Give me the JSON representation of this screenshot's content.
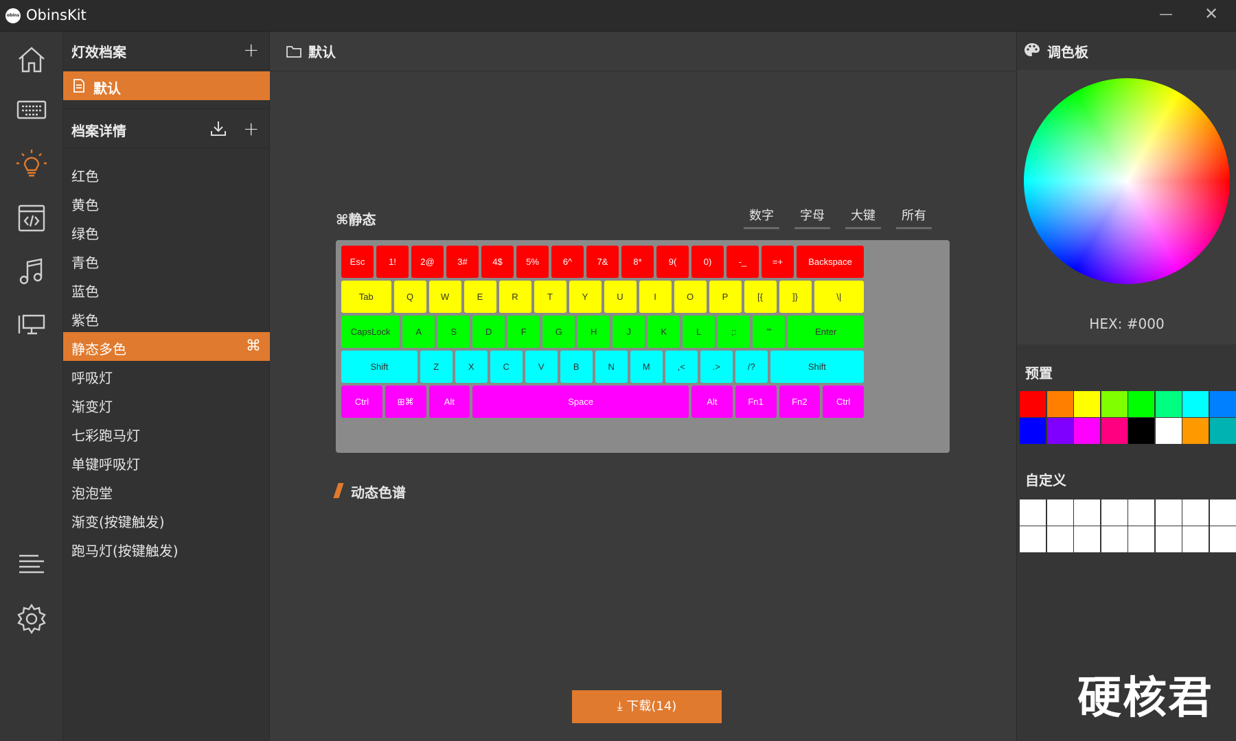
{
  "app": {
    "title": "ObinsKit",
    "logo_text": "obins"
  },
  "window": {
    "minimize": "—",
    "close": "✕"
  },
  "rail": [
    "home-icon",
    "keyboard-icon",
    "lighting-icon",
    "macro-icon",
    "music-icon",
    "monitor-icon",
    "menu-icon",
    "settings-icon"
  ],
  "profiles": {
    "title": "灯效档案",
    "add": "+",
    "items": [
      {
        "label": "默认",
        "selected": true
      }
    ]
  },
  "details": {
    "title": "档案详情",
    "add": "+",
    "items": [
      {
        "label": "红色"
      },
      {
        "label": "黄色"
      },
      {
        "label": "绿色"
      },
      {
        "label": "青色"
      },
      {
        "label": "蓝色"
      },
      {
        "label": "紫色"
      },
      {
        "label": "静态多色",
        "active": true,
        "badge": "⌘"
      },
      {
        "label": "呼吸灯"
      },
      {
        "label": "渐变灯"
      },
      {
        "label": "七彩跑马灯"
      },
      {
        "label": "单键呼吸灯"
      },
      {
        "label": "泡泡堂"
      },
      {
        "label": "渐变(按键触发)"
      },
      {
        "label": "跑马灯(按键触发)"
      }
    ]
  },
  "main": {
    "title": "默认",
    "static_label": "⌘静态",
    "filters": [
      "数字",
      "字母",
      "大键",
      "所有"
    ],
    "dynamic_label": "动态色谱",
    "download_label": "下载(14)",
    "keyboard": {
      "colors": {
        "red": "#ff0000",
        "yellow": "#ffff00",
        "green": "#00ff00",
        "cyan": "#00ffff",
        "magenta": "#ff00ff"
      },
      "rows": [
        {
          "color": "red",
          "keys": [
            {
              "l": "Esc",
              "w": 1
            },
            {
              "l": "1!",
              "w": 1
            },
            {
              "l": "2@",
              "w": 1
            },
            {
              "l": "3#",
              "w": 1
            },
            {
              "l": "4$",
              "w": 1
            },
            {
              "l": "5%",
              "w": 1
            },
            {
              "l": "6^",
              "w": 1
            },
            {
              "l": "7&",
              "w": 1
            },
            {
              "l": "8*",
              "w": 1
            },
            {
              "l": "9(",
              "w": 1
            },
            {
              "l": "0)",
              "w": 1
            },
            {
              "l": "-_",
              "w": 1
            },
            {
              "l": "=+",
              "w": 1
            },
            {
              "l": "Backspace",
              "w": 2
            }
          ]
        },
        {
          "color": "yellow",
          "keys": [
            {
              "l": "Tab",
              "w": 1.5
            },
            {
              "l": "Q",
              "w": 1
            },
            {
              "l": "W",
              "w": 1
            },
            {
              "l": "E",
              "w": 1
            },
            {
              "l": "R",
              "w": 1
            },
            {
              "l": "T",
              "w": 1
            },
            {
              "l": "Y",
              "w": 1
            },
            {
              "l": "U",
              "w": 1
            },
            {
              "l": "I",
              "w": 1
            },
            {
              "l": "O",
              "w": 1
            },
            {
              "l": "P",
              "w": 1
            },
            {
              "l": "[{",
              "w": 1
            },
            {
              "l": "]}",
              "w": 1
            },
            {
              "l": "\\|",
              "w": 1.5
            }
          ]
        },
        {
          "color": "green",
          "keys": [
            {
              "l": "CapsLock",
              "w": 1.75
            },
            {
              "l": "A",
              "w": 1
            },
            {
              "l": "S",
              "w": 1
            },
            {
              "l": "D",
              "w": 1
            },
            {
              "l": "F",
              "w": 1
            },
            {
              "l": "G",
              "w": 1
            },
            {
              "l": "H",
              "w": 1
            },
            {
              "l": "J",
              "w": 1
            },
            {
              "l": "K",
              "w": 1
            },
            {
              "l": "L",
              "w": 1
            },
            {
              "l": ";:",
              "w": 1
            },
            {
              "l": "'\"",
              "w": 1
            },
            {
              "l": "Enter",
              "w": 2.25
            }
          ]
        },
        {
          "color": "cyan",
          "keys": [
            {
              "l": "Shift",
              "w": 2.25
            },
            {
              "l": "Z",
              "w": 1
            },
            {
              "l": "X",
              "w": 1
            },
            {
              "l": "C",
              "w": 1
            },
            {
              "l": "V",
              "w": 1
            },
            {
              "l": "B",
              "w": 1
            },
            {
              "l": "N",
              "w": 1
            },
            {
              "l": "M",
              "w": 1
            },
            {
              "l": ",<",
              "w": 1
            },
            {
              "l": ".>",
              "w": 1
            },
            {
              "l": "/?",
              "w": 1
            },
            {
              "l": "Shift",
              "w": 2.75
            }
          ]
        },
        {
          "color": "magenta",
          "keys": [
            {
              "l": "Ctrl",
              "w": 1.25
            },
            {
              "l": "⊞⌘",
              "w": 1.25
            },
            {
              "l": "Alt",
              "w": 1.25
            },
            {
              "l": "Space",
              "w": 6.25
            },
            {
              "l": "Alt",
              "w": 1.25
            },
            {
              "l": "Fn1",
              "w": 1.25
            },
            {
              "l": "Fn2",
              "w": 1.25
            },
            {
              "l": "Ctrl",
              "w": 1.25
            }
          ]
        }
      ]
    }
  },
  "palette": {
    "title": "调色板",
    "hex": "HEX: #000",
    "preset_label": "预置",
    "presets": [
      "#ff0000",
      "#ff8000",
      "#ffff00",
      "#80ff00",
      "#00ff00",
      "#00ff80",
      "#00ffff",
      "#0080ff",
      "#0000ff",
      "#8000ff",
      "#ff00ff",
      "#ff0080",
      "#000000",
      "#ffffff",
      "#ff9900",
      "#00b3b3"
    ],
    "custom_label": "自定义",
    "custom_count": 16,
    "watermark": "硬核君"
  }
}
